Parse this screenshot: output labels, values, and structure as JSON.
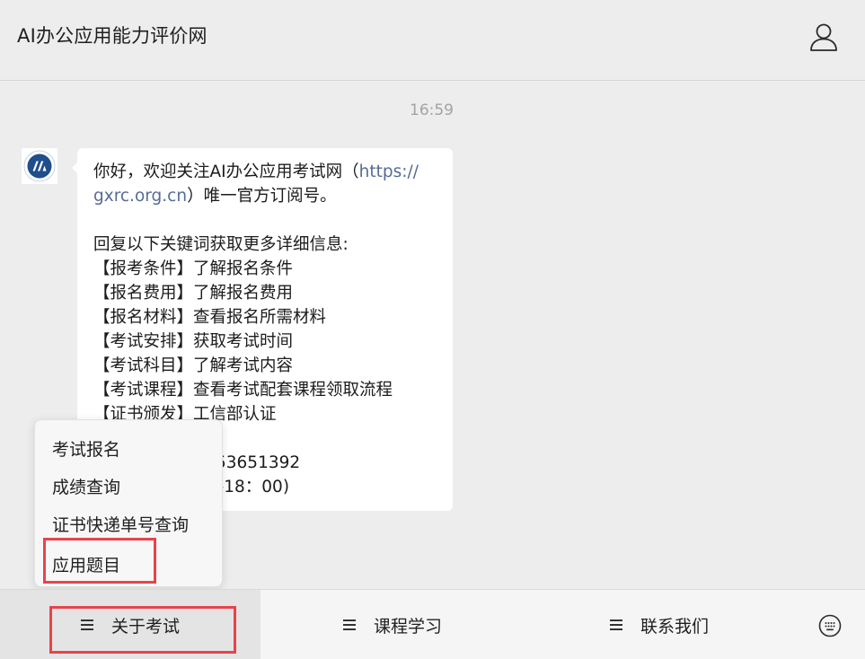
{
  "header": {
    "title": "AI办公应用能力评价网",
    "profile_icon": "person-outline-icon"
  },
  "chat": {
    "timestamp": "16:59",
    "message": {
      "line1_prefix": "你好，欢迎关注AI办公应用考试网（",
      "link_part1": "https://",
      "link_part2": "gxrc.org.cn",
      "line2_suffix": "）唯一官方订阅号。",
      "intro": "回复以下关键词获取更多详细信息:",
      "keywords": [
        "【报考条件】了解报名条件",
        "【报名费用】了解报名费用",
        "【报名材料】查看报名所需材料",
        "【考试安排】获取考试时间",
        "【考试科目】了解考试内容",
        "【考试课程】查看考试配套课程领取流程",
        "【证书颁发】工信部认证"
      ],
      "phone_fragment": "53651392",
      "hours_fragment": "–18：00)"
    }
  },
  "popup_menu": {
    "items": [
      "考试报名",
      "成绩查询",
      "证书快递单号查询",
      "应用题目"
    ]
  },
  "bottom_menu": {
    "tabs": [
      "关于考试",
      "课程学习",
      "联系我们"
    ],
    "keyboard_icon": "keyboard-icon"
  },
  "colors": {
    "background": "#ededed",
    "link": "#576b95",
    "highlight": "#e8434c",
    "avatar_brand": "#1f4e8c"
  }
}
